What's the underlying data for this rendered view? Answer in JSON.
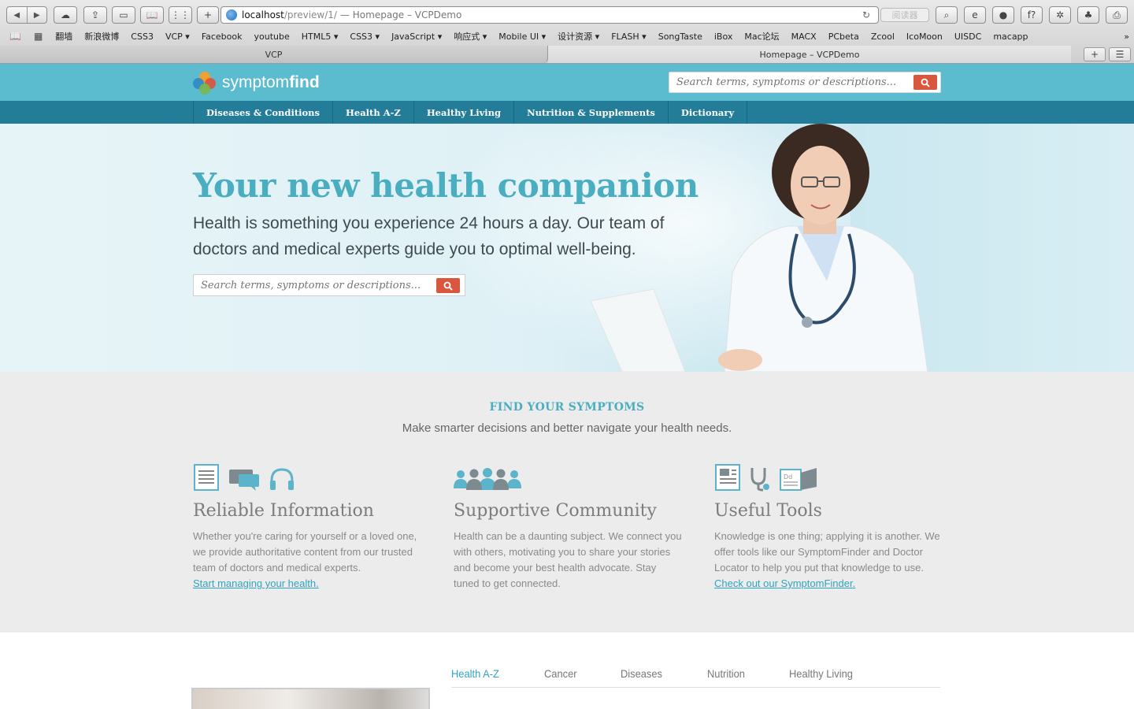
{
  "browser": {
    "url_host": "localhost",
    "url_path": "/preview/1/",
    "url_title": "— Homepage – VCPDemo",
    "reader_label": "阅读器",
    "bookmarks": [
      "翻墙",
      "新浪微博",
      "CSS3",
      "VCP ▾",
      "Facebook",
      "youtube",
      "HTML5 ▾",
      "CSS3 ▾",
      "JavaScript ▾",
      "响应式 ▾",
      "Mobile UI ▾",
      "设计资源 ▾",
      "FLASH ▾",
      "SongTaste",
      "iBox",
      "Mac论坛",
      "MACX",
      "PCbeta",
      "Zcool",
      "IcoMoon",
      "UISDC",
      "macapp"
    ],
    "tabs": [
      "VCP",
      "Homepage – VCPDemo"
    ]
  },
  "header": {
    "logo_light": "symptom",
    "logo_bold": "find",
    "search_placeholder": "Search terms, symptoms or descriptions..."
  },
  "nav": [
    "Diseases & Conditions",
    "Health A-Z",
    "Healthy Living",
    "Nutrition & Supplements",
    "Dictionary"
  ],
  "hero": {
    "title": "Your new health companion",
    "subtitle": "Health is something you experience 24 hours a day. Our team of doctors and medical experts guide you to optimal well-being.",
    "search_placeholder": "Search terms, symptoms or descriptions..."
  },
  "symptoms": {
    "title": "FIND YOUR SYMPTOMS",
    "subtitle": "Make smarter decisions and better navigate your health needs.",
    "columns": [
      {
        "title": "Reliable Information",
        "text": "Whether you're caring for yourself or a loved one, we provide authoritative content from our trusted team of doctors and medical experts.",
        "link": "Start managing your health."
      },
      {
        "title": "Supportive Community",
        "text": "Health can be a daunting subject. We connect you with others, motivating you to share your stories and become your best health advocate. Stay tuned to get connected.",
        "link": ""
      },
      {
        "title": "Useful Tools",
        "text": "Knowledge is one thing; applying it is another. We offer tools like our SymptomFinder and Doctor Locator to help you put that knowledge to use.",
        "link": "Check out our SymptomFinder."
      }
    ]
  },
  "bottom_tabs": [
    "Health A-Z",
    "Cancer",
    "Diseases",
    "Nutrition",
    "Healthy Living"
  ],
  "colors": {
    "header": "#5bbccf",
    "nav": "#237d99",
    "accent": "#4aaec0",
    "search_button": "#d9573e"
  }
}
